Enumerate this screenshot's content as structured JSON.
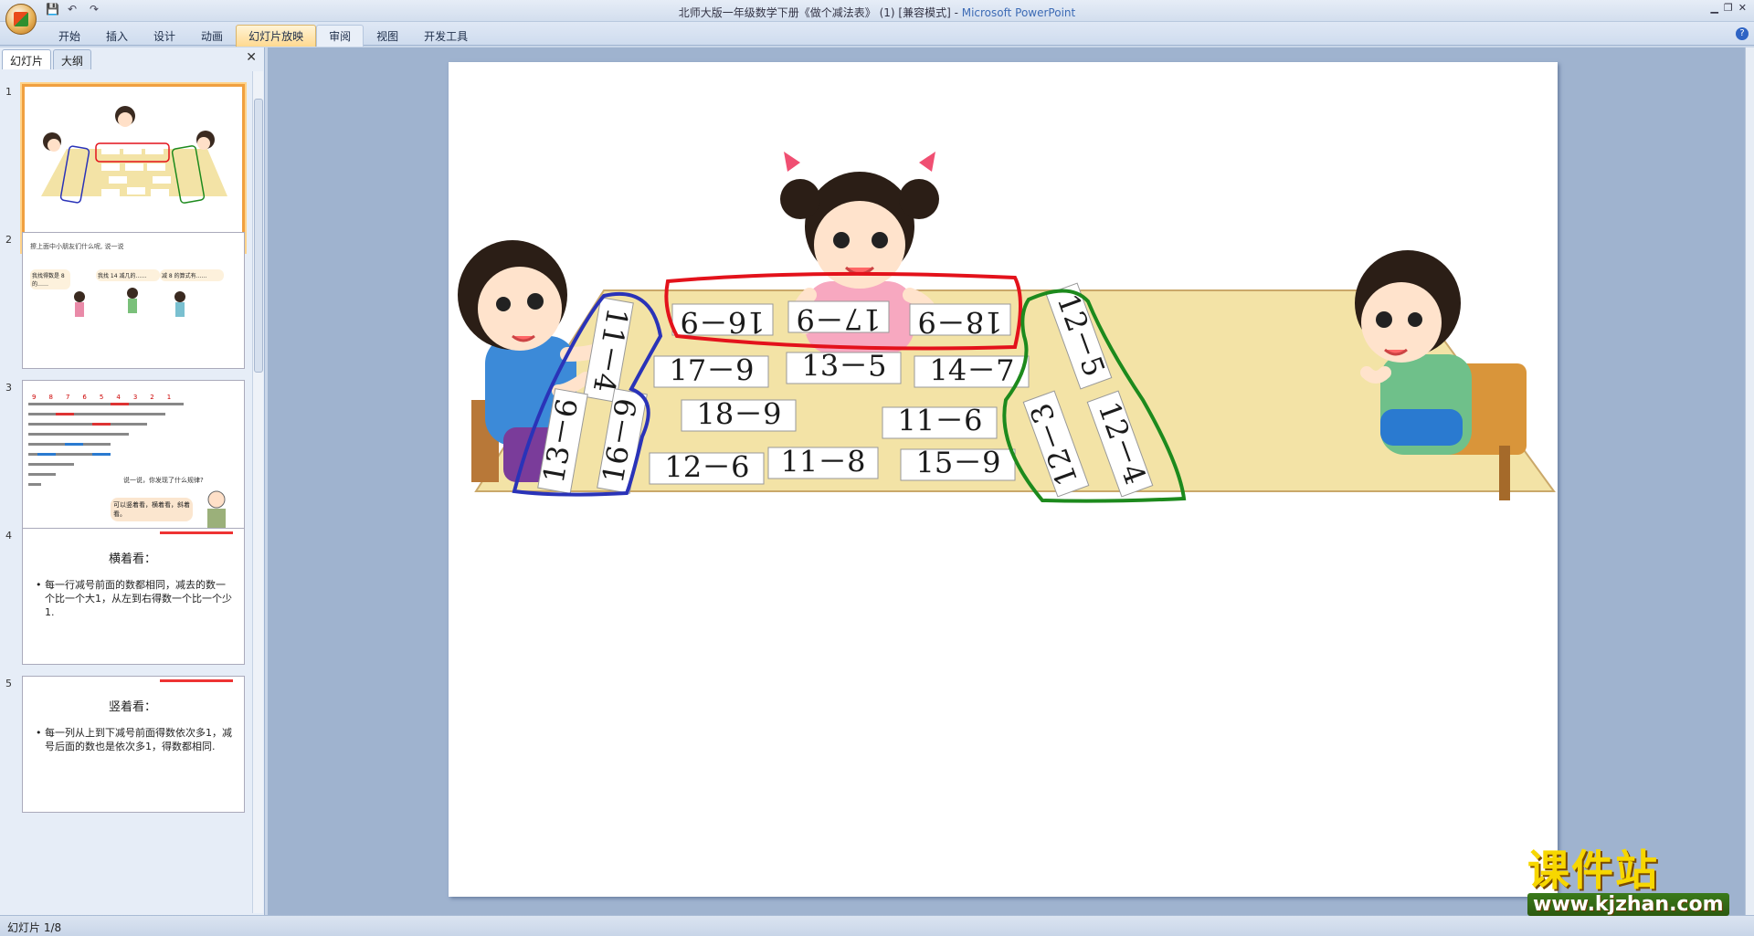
{
  "window": {
    "title": "北师大版一年级数学下册《做个减法表》 (1) [兼容模式] - ",
    "app_name": "Microsoft PowerPoint"
  },
  "ribbon": {
    "tabs": [
      "开始",
      "插入",
      "设计",
      "动画",
      "幻灯片放映",
      "审阅",
      "视图",
      "开发工具"
    ],
    "active_tab": "幻灯片放映"
  },
  "panel": {
    "tabs": [
      "幻灯片",
      "大纲"
    ],
    "slides": [
      {
        "num": "1"
      },
      {
        "num": "2",
        "texts": [
          "擦上面中小朋友们什么呢, 说一说",
          "我找得数是 8 的……",
          "我找 14 减几的……",
          "减 8 的算式有……"
        ]
      },
      {
        "num": "3",
        "header": [
          "9",
          "8",
          "7",
          "6",
          "5",
          "4",
          "3",
          "2",
          "1"
        ],
        "caption": "说一说，你发现了什么规律?",
        "bubble": "可以竖着看，横着看，斜着看。"
      },
      {
        "num": "4",
        "title": "横着看：",
        "body": "每一行减号前面的数都相同，减去的数一个比一个大1，从左到右得数一个比一个少1."
      },
      {
        "num": "5",
        "title": "竖着看：",
        "body": "每一列从上到下减号前面得数依次多1，减号后面的数也是依次多1，得数都相同."
      }
    ]
  },
  "slide": {
    "cards": {
      "top": [
        "16－9",
        "17－9",
        "18－9"
      ],
      "row1": [
        "17－9",
        "13－5",
        "14－7"
      ],
      "row2": [
        "18－9",
        "11－6"
      ],
      "row3": [
        "12－6",
        "11－8",
        "15－9"
      ],
      "left": [
        "11－4",
        "13－6",
        "16－9"
      ],
      "right": [
        "12－5",
        "12－3",
        "12－4"
      ]
    }
  },
  "status": {
    "text": "幻灯片 1/8"
  },
  "watermark": {
    "cn": "课件站",
    "url": "www.kjzhan.com"
  },
  "colors": {
    "red_loop": "#e3121b",
    "blue_loop": "#2a33b8",
    "green_loop": "#1d8a1d",
    "table": "#f3e3a6"
  }
}
